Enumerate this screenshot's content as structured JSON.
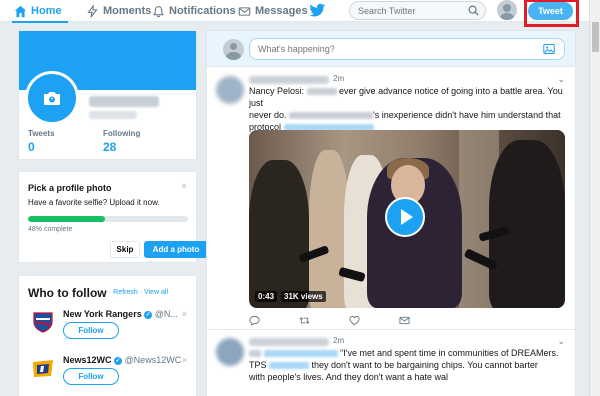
{
  "nav": {
    "home": "Home",
    "moments": "Moments",
    "notifications": "Notifications",
    "messages": "Messages",
    "search_placeholder": "Search Twitter",
    "tweet_button": "Tweet"
  },
  "profile": {
    "tweets_label": "Tweets",
    "tweets_count": "0",
    "following_label": "Following",
    "following_count": "28"
  },
  "photo_prompt": {
    "title": "Pick a profile photo",
    "subtitle": "Have a favorite selfie? Upload it now.",
    "progress_text": "48% complete",
    "progress_value": 0.48,
    "skip_label": "Skip",
    "add_label": "Add a photo",
    "close": "×"
  },
  "who_to_follow": {
    "title": "Who to follow",
    "refresh": "Refresh",
    "separator": " · ",
    "view_all": "View all",
    "accounts": [
      {
        "name": "New York Rangers",
        "handle": "@N...",
        "follow_label": "Follow"
      },
      {
        "name": "News12WC",
        "handle": "@News12WC",
        "follow_label": "Follow"
      }
    ]
  },
  "compose": {
    "placeholder": "What's happening?"
  },
  "tweets": [
    {
      "time": "2m",
      "line1_start": "Nancy Pelosi: ",
      "line1_end": "ever give advance notice of going into a battle area. You just",
      "line2_start": "never do. ",
      "line2_end": "'s inexperience didn't have him understand that",
      "line3_start": "protocol",
      "video_duration": "0:43",
      "video_views": "31K views"
    },
    {
      "time": "2m",
      "line1_end": "\"I've met and spent time in communities of DREAMers.",
      "line2_start": "TPS ",
      "line2_end": "they don't want to be bargaining chips. You cannot barter",
      "line3_start": "with people's lives. And they don't want a hate wal"
    }
  ],
  "colors": {
    "brand": "#1da1f2",
    "progress": "#17bf63",
    "highlight": "#e01c24"
  }
}
